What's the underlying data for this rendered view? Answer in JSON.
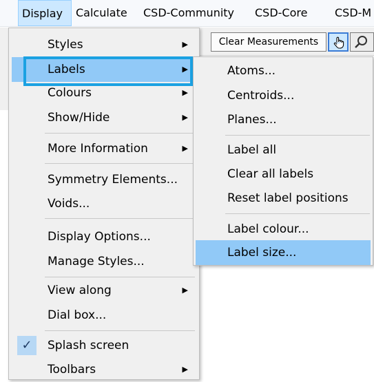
{
  "menubar": {
    "items": [
      {
        "label": "Display",
        "active": true
      },
      {
        "label": "Calculate"
      },
      {
        "label": "CSD-Community"
      },
      {
        "label": "CSD-Core"
      },
      {
        "label": "CSD-M"
      }
    ]
  },
  "toolbar": {
    "clear_measurements_label": "Clear Measurements",
    "pick_tool_icon": "hand-pointer-icon",
    "search_tool_icon": "magnifier-icon"
  },
  "display_menu": {
    "items": [
      {
        "label": "Styles",
        "submenu": true
      },
      {
        "label": "Labels",
        "submenu": true,
        "highlighted": true
      },
      {
        "label": "Colours",
        "submenu": true
      },
      {
        "label": "Show/Hide",
        "submenu": true
      },
      {
        "label": "More Information",
        "submenu": true
      },
      {
        "label": "Symmetry Elements..."
      },
      {
        "label": "Voids..."
      },
      {
        "label": "Display Options..."
      },
      {
        "label": "Manage Styles..."
      },
      {
        "label": "View along",
        "submenu": true
      },
      {
        "label": "Dial box..."
      },
      {
        "label": "Splash screen",
        "checked": true
      },
      {
        "label": "Toolbars",
        "submenu": true
      }
    ]
  },
  "labels_submenu": {
    "items": [
      {
        "label": "Atoms..."
      },
      {
        "label": "Centroids..."
      },
      {
        "label": "Planes..."
      },
      {
        "label": "Label all"
      },
      {
        "label": "Clear all labels"
      },
      {
        "label": "Reset label positions"
      },
      {
        "label": "Label colour..."
      },
      {
        "label": "Label size...",
        "highlighted": true
      }
    ]
  },
  "colors": {
    "highlight": "#91c9f7",
    "focus_outline": "#1ba1e2",
    "menu_bg": "#f0f0f0"
  }
}
